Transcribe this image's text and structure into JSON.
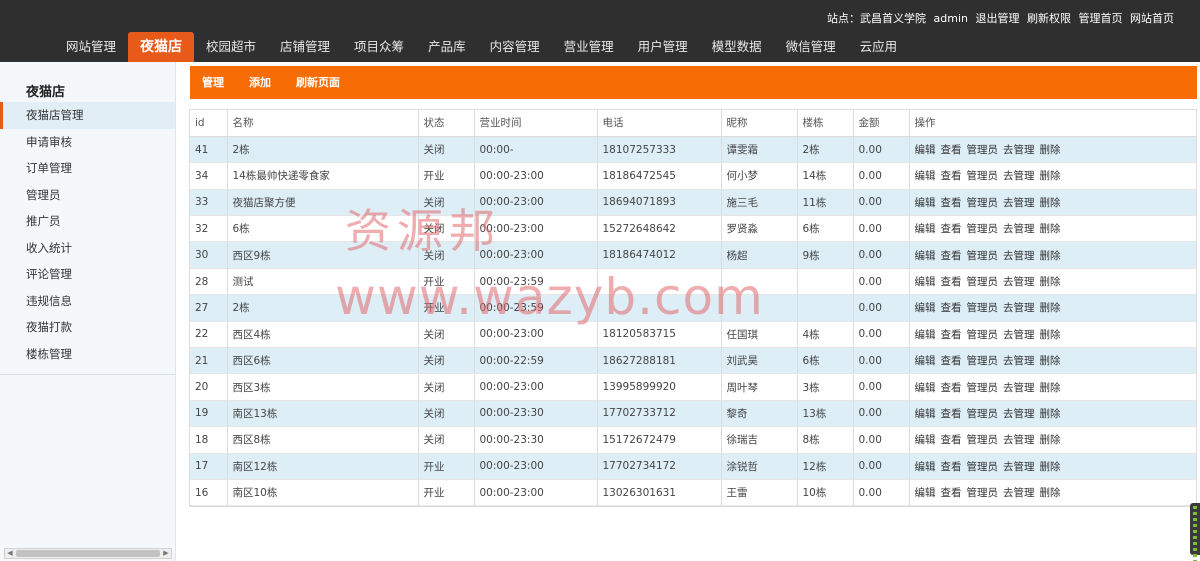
{
  "header": {
    "site_label": "站点：",
    "site_name": "武昌首义学院",
    "user": "admin",
    "logout": "退出管理",
    "refresh_perm": "刷新权限",
    "admin_home": "管理首页",
    "site_home": "网站首页"
  },
  "nav": [
    {
      "label": "网站管理"
    },
    {
      "label": "夜猫店",
      "active": true
    },
    {
      "label": "校园超市"
    },
    {
      "label": "店铺管理"
    },
    {
      "label": "项目众筹"
    },
    {
      "label": "产品库"
    },
    {
      "label": "内容管理"
    },
    {
      "label": "营业管理"
    },
    {
      "label": "用户管理"
    },
    {
      "label": "模型数据"
    },
    {
      "label": "微信管理"
    },
    {
      "label": "云应用"
    }
  ],
  "sidebar": {
    "title": "夜猫店",
    "items": [
      {
        "label": "夜猫店管理",
        "active": true
      },
      {
        "label": "申请审核"
      },
      {
        "label": "订单管理"
      },
      {
        "label": "管理员"
      },
      {
        "label": "推广员"
      },
      {
        "label": "收入统计"
      },
      {
        "label": "评论管理"
      },
      {
        "label": "违规信息"
      },
      {
        "label": "夜猫打款"
      },
      {
        "label": "楼栋管理"
      }
    ]
  },
  "actions": {
    "manage": "管理",
    "add": "添加",
    "refresh": "刷新页面"
  },
  "table": {
    "columns": [
      "id",
      "名称",
      "状态",
      "营业时间",
      "电话",
      "昵称",
      "楼栋",
      "金额",
      "操作"
    ],
    "ops": [
      "编辑",
      "查看",
      "管理员",
      "去管理",
      "删除"
    ],
    "rows": [
      [
        "41",
        "2栋",
        "关闭",
        "00:00-",
        "18107257333",
        "谭雯霜",
        "2栋",
        "0.00"
      ],
      [
        "34",
        "14栋最帅快递零食家",
        "开业",
        "00:00-23:00",
        "18186472545",
        "何小梦",
        "14栋",
        "0.00"
      ],
      [
        "33",
        "夜猫店聚方便",
        "关闭",
        "00:00-23:00",
        "18694071893",
        "施三毛",
        "11栋",
        "0.00"
      ],
      [
        "32",
        "6栋",
        "关闭",
        "00:00-23:00",
        "15272648642",
        "罗贤淼",
        "6栋",
        "0.00"
      ],
      [
        "30",
        "西区9栋",
        "关闭",
        "00:00-23:00",
        "18186474012",
        "杨超",
        "9栋",
        "0.00"
      ],
      [
        "28",
        "测试",
        "开业",
        "00:00-23:59",
        "",
        "",
        "",
        "0.00"
      ],
      [
        "27",
        "2栋",
        "开业",
        "00:00-23:59",
        "",
        "",
        "",
        "0.00"
      ],
      [
        "22",
        "西区4栋",
        "关闭",
        "00:00-23:00",
        "18120583715",
        "任国琪",
        "4栋",
        "0.00"
      ],
      [
        "21",
        "西区6栋",
        "关闭",
        "00:00-22:59",
        "18627288181",
        "刘武昊",
        "6栋",
        "0.00"
      ],
      [
        "20",
        "西区3栋",
        "关闭",
        "00:00-23:00",
        "13995899920",
        "周叶琴",
        "3栋",
        "0.00"
      ],
      [
        "19",
        "南区13栋",
        "关闭",
        "00:00-23:30",
        "17702733712",
        "黎奇",
        "13栋",
        "0.00"
      ],
      [
        "18",
        "西区8栋",
        "关闭",
        "00:00-23:30",
        "15172672479",
        "徐瑞吉",
        "8栋",
        "0.00"
      ],
      [
        "17",
        "南区12栋",
        "开业",
        "00:00-23:00",
        "17702734172",
        "涂锐哲",
        "12栋",
        "0.00"
      ],
      [
        "16",
        "南区10栋",
        "开业",
        "00:00-23:00",
        "13026301631",
        "王雷",
        "10栋",
        "0.00"
      ]
    ]
  },
  "watermark": {
    "line1": "资源邦",
    "line2": "www.wazyb.com"
  },
  "colors": {
    "topbar_bg": "#2f2f2f",
    "nav_active": "#e85a1a",
    "actionbar": "#f86c06",
    "row_alt": "#ddeef7",
    "sidebar_bg": "#f4f8fb"
  }
}
